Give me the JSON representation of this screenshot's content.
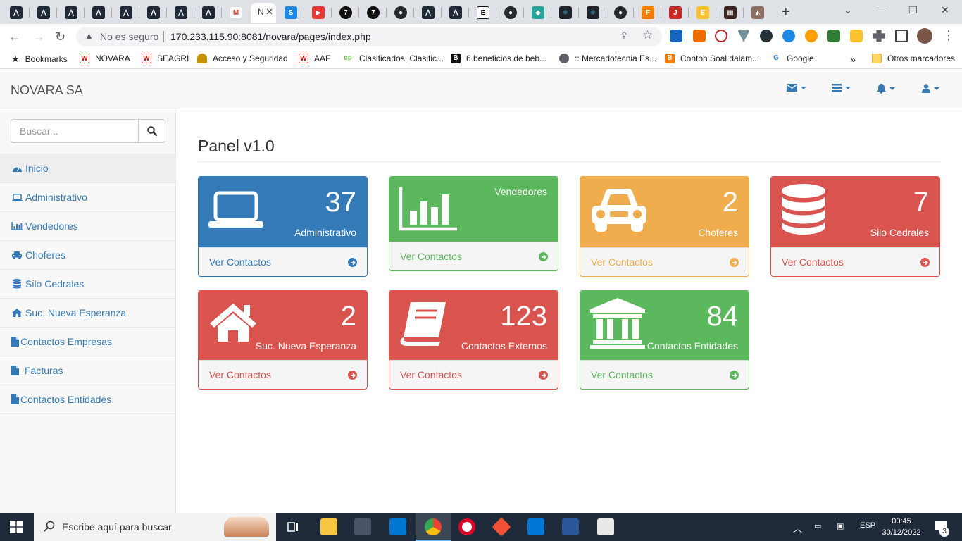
{
  "browser": {
    "url_warning": "No es seguro",
    "url": "170.233.115.90:8081/novara/pages/index.php",
    "active_tab_label": "N",
    "bookmarks": [
      {
        "label": "Bookmarks",
        "icon": "star-icon",
        "color": "#3c4043"
      },
      {
        "label": "NOVARA",
        "icon": "w-favicon",
        "color": "#b71c1c"
      },
      {
        "label": "SEAGRI",
        "icon": "w-favicon",
        "color": "#b71c1c"
      },
      {
        "label": "Acceso y Seguridad",
        "icon": "helmet-favicon",
        "color": "#c79100"
      },
      {
        "label": "AAF",
        "icon": "w-favicon",
        "color": "#b71c1c"
      },
      {
        "label": "Clasificados, Clasific...",
        "icon": "cp-favicon",
        "color": "#6bbf4a"
      },
      {
        "label": "6 beneficios de beb...",
        "icon": "b-favicon",
        "color": "#111111"
      },
      {
        "label": ":: Mercadotecnia Es...",
        "icon": "globe-favicon",
        "color": "#5f6368"
      },
      {
        "label": "Contoh Soal dalam...",
        "icon": "blogger-favicon",
        "color": "#f57c00"
      },
      {
        "label": "Google",
        "icon": "google-favicon",
        "color": "#4285f4"
      }
    ],
    "more_bookmarks": "»",
    "other_bookmarks": "Otros marcadores"
  },
  "app": {
    "brand": "NOVARA SA",
    "search_placeholder": "Buscar...",
    "sidebar": [
      {
        "label": "Inicio",
        "icon": "dashboard-icon",
        "name": "inicio",
        "active": true
      },
      {
        "label": "Administrativo",
        "icon": "laptop-icon",
        "name": "administrativo"
      },
      {
        "label": "Vendedores",
        "icon": "bar-chart-icon",
        "name": "vendedores"
      },
      {
        "label": "Choferes",
        "icon": "car-icon",
        "name": "choferes"
      },
      {
        "label": "Silo Cedrales",
        "icon": "database-icon",
        "name": "silo-cedrales"
      },
      {
        "label": "Suc. Nueva Esperanza",
        "icon": "home-icon",
        "name": "suc-nueva-esperanza"
      },
      {
        "label": "Contactos Empresas",
        "icon": "file-icon",
        "name": "contactos-empresas"
      },
      {
        "label": "Facturas",
        "icon": "file-icon",
        "name": "facturas"
      },
      {
        "label": "Contactos Entidades",
        "icon": "file-icon",
        "name": "contactos-entidades"
      }
    ],
    "page_title": "Panel v1.0",
    "panels": [
      {
        "count": "37",
        "label": "Administrativo",
        "link": "Ver Contactos",
        "color": "blue",
        "icon": "laptop-icon"
      },
      {
        "count": "",
        "label": "Vendedores",
        "link": "Ver Contactos",
        "color": "green",
        "icon": "bar-chart-icon"
      },
      {
        "count": "2",
        "label": "Choferes",
        "link": "Ver Contactos",
        "color": "yellow",
        "icon": "car-icon"
      },
      {
        "count": "7",
        "label": "Silo Cedrales",
        "link": "Ver Contactos",
        "color": "red",
        "icon": "database-icon"
      },
      {
        "count": "2",
        "label": "Suc. Nueva Esperanza",
        "link": "Ver Contactos",
        "color": "red",
        "icon": "home-icon"
      },
      {
        "count": "123",
        "label": "Contactos Externos",
        "link": "Ver Contactos",
        "color": "red",
        "icon": "book-icon"
      },
      {
        "count": "84",
        "label": "Contactos Entidades",
        "link": "Ver Contactos",
        "color": "green",
        "icon": "bank-icon"
      }
    ]
  },
  "taskbar": {
    "search_placeholder": "Escribe aquí para buscar",
    "language": "ESP",
    "time": "00:45",
    "date": "30/12/2022",
    "notifications": "3"
  },
  "colors": {
    "primary": "#337ab7",
    "success": "#5cb85c",
    "warning": "#f0ad4e",
    "danger": "#d9534f"
  }
}
